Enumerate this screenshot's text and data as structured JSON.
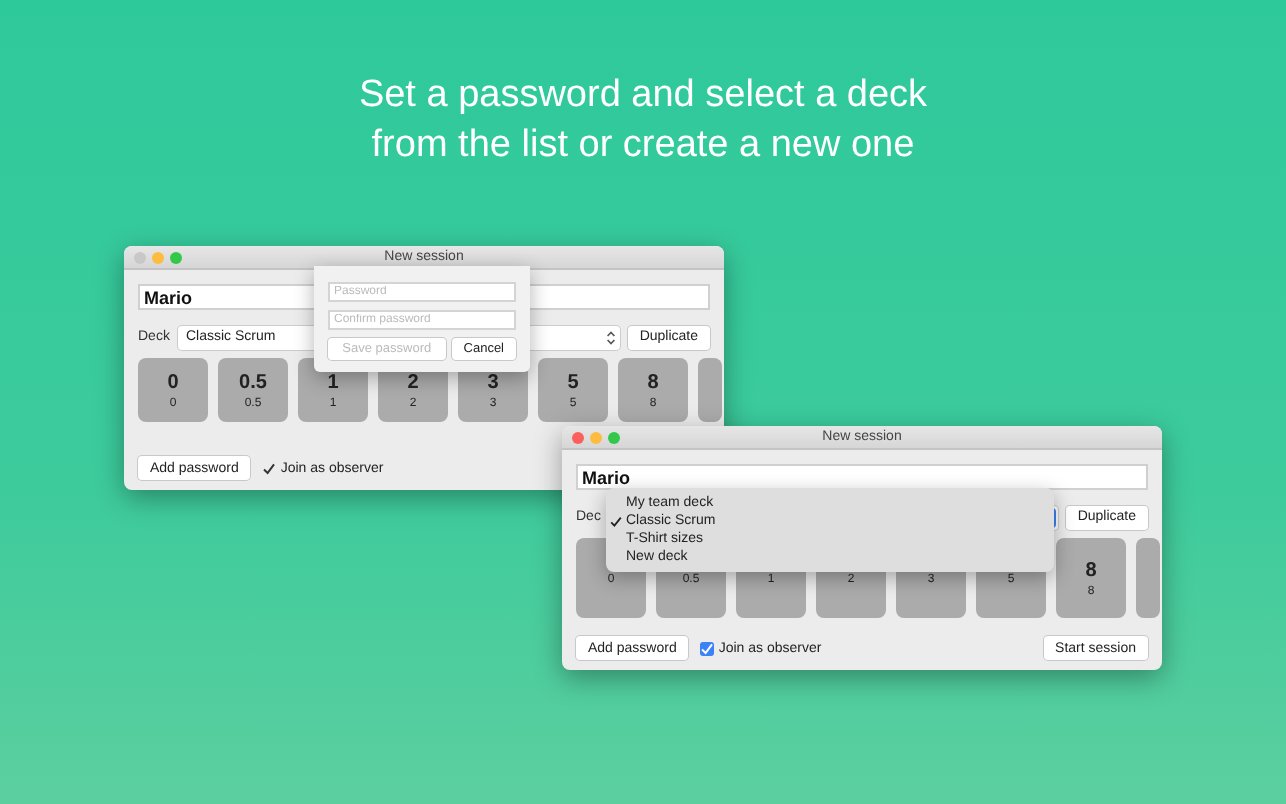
{
  "headline": [
    "Set a password and select a deck",
    "from the list or create a new one"
  ],
  "windows": [
    {
      "title": "New session",
      "active": false,
      "name": "Mario",
      "deck_label": "Deck",
      "deck_value": "Classic Scrum",
      "duplicate": "Duplicate",
      "cards": [
        {
          "value": "0",
          "label": "0"
        },
        {
          "value": "0.5",
          "label": "0.5"
        },
        {
          "value": "1",
          "label": "1"
        },
        {
          "value": "2",
          "label": "2"
        },
        {
          "value": "3",
          "label": "3"
        },
        {
          "value": "5",
          "label": "5"
        },
        {
          "value": "8",
          "label": "8"
        }
      ],
      "add_password": "Add password",
      "observer": {
        "label": "Join as observer",
        "checked": true
      },
      "password_popover": {
        "password_placeholder": "Password",
        "confirm_placeholder": "Confirm password",
        "save": "Save password",
        "save_disabled": true,
        "cancel": "Cancel"
      }
    },
    {
      "title": "New session",
      "active": true,
      "name": "Mario",
      "deck_label": "Dec",
      "duplicate": "Duplicate",
      "cards": [
        {
          "label": "0"
        },
        {
          "label": "0.5"
        },
        {
          "label": "1"
        },
        {
          "label": "2"
        },
        {
          "label": "3"
        },
        {
          "label": "5"
        },
        {
          "value": "8",
          "label": "8"
        }
      ],
      "add_password": "Add password",
      "observer": {
        "label": "Join as observer",
        "checked": true
      },
      "start": "Start session",
      "deck_menu": [
        {
          "label": "My team deck",
          "selected": false
        },
        {
          "label": "Classic Scrum",
          "selected": true
        },
        {
          "label": "T-Shirt sizes",
          "selected": false
        },
        {
          "label": "New deck",
          "selected": false
        }
      ]
    }
  ]
}
